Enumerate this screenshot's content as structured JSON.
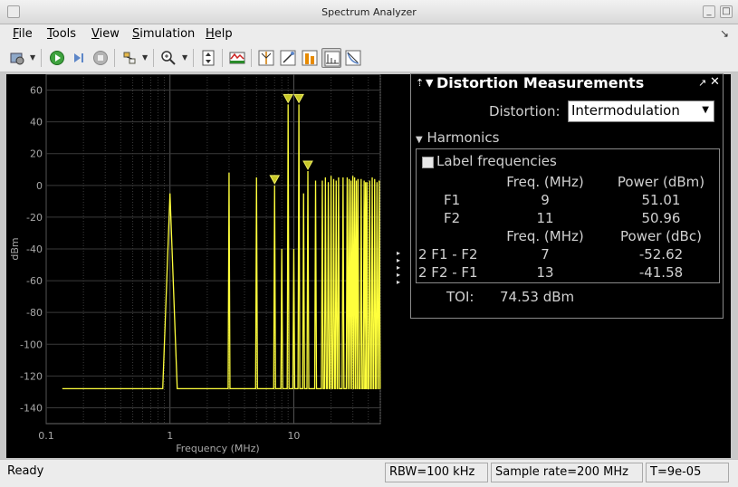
{
  "window": {
    "title": "Spectrum Analyzer"
  },
  "menu": {
    "items": [
      {
        "label_u": "F",
        "label_rest": "ile"
      },
      {
        "label_u": "T",
        "label_rest": "ools"
      },
      {
        "label_u": "V",
        "label_rest": "iew"
      },
      {
        "label_u": "S",
        "label_rest": "imulation"
      },
      {
        "label_u": "H",
        "label_rest": "elp"
      }
    ]
  },
  "toolbar": {
    "buttons": [
      "settings-icon",
      "run-icon",
      "step-forward-icon",
      "stop-icon",
      "highlight-signal-icon",
      "zoom-in-icon",
      "autoscale-icon",
      "spectrum-settings-icon",
      "cursor-measurements-icon",
      "peak-finder-icon",
      "channel-measurements-icon",
      "distortion-measurements-icon",
      "ccdf-measurements-icon"
    ]
  },
  "chart_data": {
    "type": "line",
    "xlabel": "Frequency (MHz)",
    "ylabel": "dBm",
    "xscale": "log",
    "xlim": [
      0.1,
      50
    ],
    "ylim": [
      -150,
      70
    ],
    "x_ticks": [
      "0.1",
      "1",
      "10"
    ],
    "y_ticks": [
      "60",
      "40",
      "20",
      "0",
      "-20",
      "-40",
      "-60",
      "-80",
      "-100",
      "-120",
      "-140"
    ],
    "y_tick_values": [
      60,
      40,
      20,
      0,
      -20,
      -40,
      -60,
      -80,
      -100,
      -120,
      -140
    ],
    "grid": true,
    "line_color": "#ffff3c",
    "noise_floor": -128,
    "x_start": 0.135,
    "peaks": [
      {
        "f": 1,
        "p": -5,
        "wide": true
      },
      {
        "f": 3,
        "p": 8
      },
      {
        "f": 5,
        "p": 5
      },
      {
        "f": 7,
        "p": 0
      },
      {
        "f": 8,
        "p": -40
      },
      {
        "f": 9,
        "p": 51.01
      },
      {
        "f": 10,
        "p": -40
      },
      {
        "f": 11,
        "p": 50.96
      },
      {
        "f": 12,
        "p": -5
      },
      {
        "f": 13,
        "p": 9
      },
      {
        "f": 15,
        "p": 3
      },
      {
        "f": 17,
        "p": 3
      },
      {
        "f": 18,
        "p": 5
      },
      {
        "f": 19,
        "p": 2
      },
      {
        "f": 20,
        "p": 6
      },
      {
        "f": 21,
        "p": 4
      },
      {
        "f": 22,
        "p": 3
      },
      {
        "f": 23,
        "p": 5
      },
      {
        "f": 25,
        "p": 5
      },
      {
        "f": 27,
        "p": 5
      },
      {
        "f": 28,
        "p": 4
      },
      {
        "f": 29,
        "p": 3
      },
      {
        "f": 30,
        "p": 6
      },
      {
        "f": 31,
        "p": 5
      },
      {
        "f": 32,
        "p": 3
      },
      {
        "f": 33,
        "p": 4
      },
      {
        "f": 35,
        "p": 4
      },
      {
        "f": 37,
        "p": 3
      },
      {
        "f": 38,
        "p": 2
      },
      {
        "f": 39,
        "p": 2
      },
      {
        "f": 41,
        "p": 3
      },
      {
        "f": 43,
        "p": 5
      },
      {
        "f": 45,
        "p": 4
      },
      {
        "f": 47,
        "p": 2
      },
      {
        "f": 49,
        "p": 3
      }
    ],
    "markers": [
      {
        "f": 7,
        "p": 0
      },
      {
        "f": 9,
        "p": 51.01
      },
      {
        "f": 11,
        "p": 50.96
      },
      {
        "f": 13,
        "p": 9
      }
    ]
  },
  "panel": {
    "title": "Distortion Measurements",
    "distortion_label": "Distortion:",
    "distortion_value": "Intermodulation",
    "harmonics_label": "Harmonics",
    "label_frequencies": "Label frequencies",
    "table1_header": [
      "Freq. (MHz)",
      "Power (dBm)"
    ],
    "table1_rows": [
      {
        "name": "F1",
        "freq": "9",
        "power": "51.01"
      },
      {
        "name": "F2",
        "freq": "11",
        "power": "50.96"
      }
    ],
    "table2_header": [
      "Freq. (MHz)",
      "Power (dBc)"
    ],
    "table2_rows": [
      {
        "name": "2 F1 - F2",
        "freq": "7",
        "power": "-52.62"
      },
      {
        "name": "2 F2 - F1",
        "freq": "13",
        "power": "-41.58"
      }
    ],
    "toi_label": "TOI:",
    "toi_value": "74.53 dBm"
  },
  "status": {
    "state": "Ready",
    "rbw": "RBW=100 kHz",
    "sample_rate": "Sample rate=200 MHz",
    "time": "T=9e-05"
  }
}
